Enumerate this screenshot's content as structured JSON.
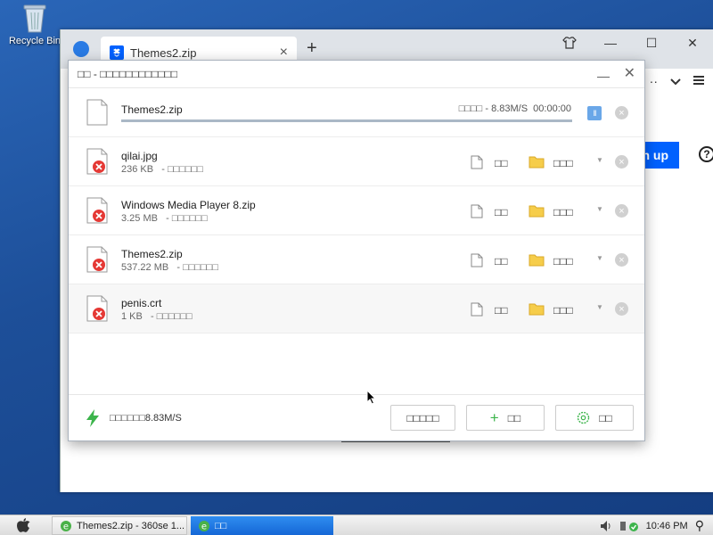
{
  "desktop": {
    "recycle_bin_label": "Recycle Bin"
  },
  "browser": {
    "tab_title": "Themes2.zip",
    "tab_close": "×",
    "new_tab": "+",
    "window_controls": {
      "minimize": "—",
      "maximize": "☐",
      "close": "✕"
    },
    "signup_label": "n up",
    "help_label": "?"
  },
  "dialog": {
    "title": "□□ - □□□□□□□□□□□□",
    "minimize_icon": "minimize-icon",
    "close_glyph": "✕",
    "active": {
      "name": "Themes2.zip",
      "progress_text": "□□□□ - 8.83M/S  00:00:00",
      "progress_pct": 100,
      "pause_glyph": "II",
      "close_glyph": "×"
    },
    "rows": [
      {
        "name": "qilai.jpg",
        "size": "236 KB",
        "status": "- □□□□□□",
        "open": "□□",
        "folder": "□□□",
        "more": "▼",
        "close": "×"
      },
      {
        "name": "Windows Media Player 8.zip",
        "size": "3.25 MB",
        "status": "- □□□□□□",
        "open": "□□",
        "folder": "□□□",
        "more": "▼",
        "close": "×"
      },
      {
        "name": "Themes2.zip",
        "size": "537.22 MB",
        "status": "- □□□□□□",
        "open": "□□",
        "folder": "□□□",
        "more": "▼",
        "close": "×"
      },
      {
        "name": "penis.crt",
        "size": "1 KB",
        "status": "- □□□□□□",
        "open": "□□",
        "folder": "□□□",
        "more": "▼",
        "close": "×"
      }
    ],
    "footer": {
      "speed_text": "□□□□□□8.83M/S",
      "clear_button": "□□□□□",
      "new_button": "□□",
      "new_glyph": "+",
      "settings_button": "□□"
    }
  },
  "taskbar": {
    "start_glyph": "",
    "task1_label": "Themes2.zip - 360se 1...",
    "task2_label": "□□",
    "clock": "10:46 PM",
    "search_glyph": "⚲"
  },
  "colors": {
    "accent": "#0061fe",
    "progress": "#aab8c6",
    "error": "#e53935",
    "folder": "#f6cd4a"
  }
}
